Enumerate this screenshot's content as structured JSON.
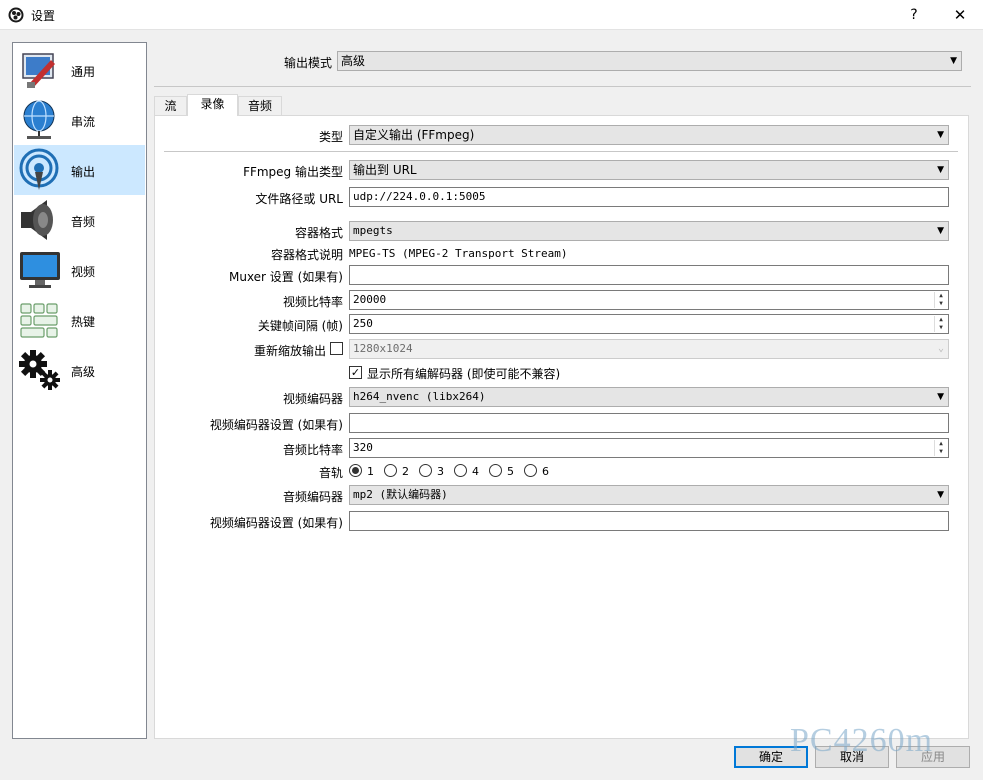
{
  "window": {
    "title": "设置",
    "help": "?",
    "close": "✕"
  },
  "sidebar": {
    "items": [
      {
        "label": "通用"
      },
      {
        "label": "串流"
      },
      {
        "label": "输出"
      },
      {
        "label": "音频"
      },
      {
        "label": "视频"
      },
      {
        "label": "热键"
      },
      {
        "label": "高级"
      }
    ]
  },
  "output_mode": {
    "label": "输出模式",
    "value": "高级"
  },
  "tabs": [
    {
      "label": "流"
    },
    {
      "label": "录像"
    },
    {
      "label": "音频"
    }
  ],
  "recording": {
    "type": {
      "label": "类型",
      "value": "自定义输出 (FFmpeg)"
    },
    "ffmpeg_output_type": {
      "label": "FFmpeg 输出类型",
      "value": "输出到 URL"
    },
    "file_path": {
      "label": "文件路径或 URL",
      "value": "udp://224.0.0.1:5005"
    },
    "container_format": {
      "label": "容器格式",
      "value": "mpegts"
    },
    "container_desc": {
      "label": "容器格式说明",
      "value": "MPEG-TS (MPEG-2 Transport Stream)"
    },
    "muxer_settings": {
      "label": "Muxer 设置 (如果有)",
      "value": ""
    },
    "video_bitrate": {
      "label": "视频比特率",
      "value": "20000"
    },
    "keyframe_interval": {
      "label": "关键帧间隔 (帧)",
      "value": "250"
    },
    "rescale_output": {
      "label": "重新缩放输出",
      "value": "1280x1024"
    },
    "show_all_codecs": {
      "label": "显示所有编解码器 (即使可能不兼容)",
      "checkmark": "✓"
    },
    "video_encoder": {
      "label": "视频编码器",
      "value": "h264_nvenc (libx264)"
    },
    "video_encoder_settings": {
      "label": "视频编码器设置 (如果有)",
      "value": ""
    },
    "audio_bitrate": {
      "label": "音频比特率",
      "value": "320"
    },
    "audio_track": {
      "label": "音轨",
      "options": [
        "1",
        "2",
        "3",
        "4",
        "5",
        "6"
      ]
    },
    "audio_encoder": {
      "label": "音频编码器",
      "value": "mp2 (默认编码器)"
    },
    "audio_encoder_settings": {
      "label": "视频编码器设置 (如果有)",
      "value": ""
    }
  },
  "buttons": {
    "ok": "确定",
    "cancel": "取消",
    "apply": "应用"
  },
  "watermark": "PC4260m",
  "icons": {
    "general": "general-settings-icon",
    "stream": "globe-network-icon",
    "output": "broadcast-antenna-icon",
    "audio": "speaker-icon",
    "video": "monitor-icon",
    "hotkeys": "keyboard-icon",
    "advanced": "gears-icon"
  }
}
